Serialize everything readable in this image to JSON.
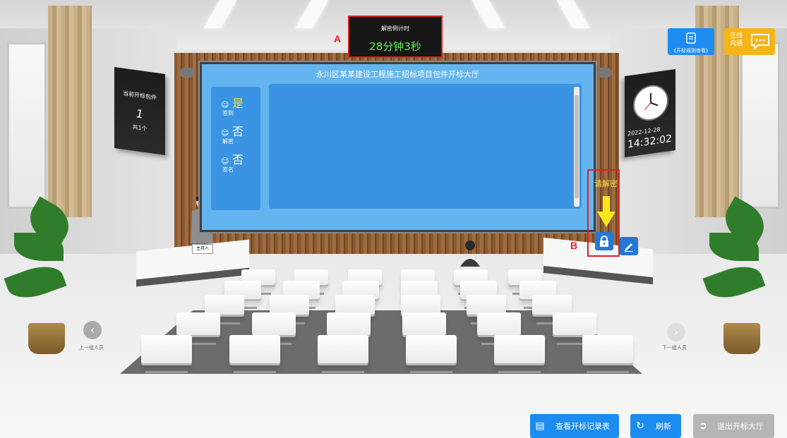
{
  "screen": {
    "title": "永川区某某建设工程施工招标项目包件开标大厅",
    "status": [
      {
        "icon": "user-icon",
        "value": "是",
        "value_color": "#f5e042",
        "label": "签到"
      },
      {
        "icon": "user-icon",
        "value": "否",
        "value_color": "#ffffff",
        "label": "解密"
      },
      {
        "icon": "user-icon",
        "value": "否",
        "value_color": "#ffffff",
        "label": "签名"
      }
    ]
  },
  "countdown": {
    "label": "解密倒计时",
    "value": "28分钟3秒"
  },
  "marks": {
    "a": "A",
    "b": "B"
  },
  "package_board": {
    "title": "当前开标包件",
    "number": "1",
    "total": "共1个"
  },
  "clock": {
    "date": "2022-12-28",
    "time": "14:32:02"
  },
  "decrypt": {
    "prompt": "请解密"
  },
  "top_buttons": {
    "rules_label": "《开标规则查看》",
    "chat_label": "在线沟通"
  },
  "nav": {
    "prev_label": "上一组人员",
    "next_label": "下一组人员"
  },
  "podium": {
    "host_label": "主持人"
  },
  "bottom_buttons": {
    "records": "查看开标记录表",
    "refresh": "刷新",
    "exit": "退出开标大厅"
  },
  "colors": {
    "accent_blue": "#1d8cf0",
    "chat_orange": "#f5b419",
    "countdown_green": "#5ff051",
    "highlight_red": "#d9231d"
  }
}
